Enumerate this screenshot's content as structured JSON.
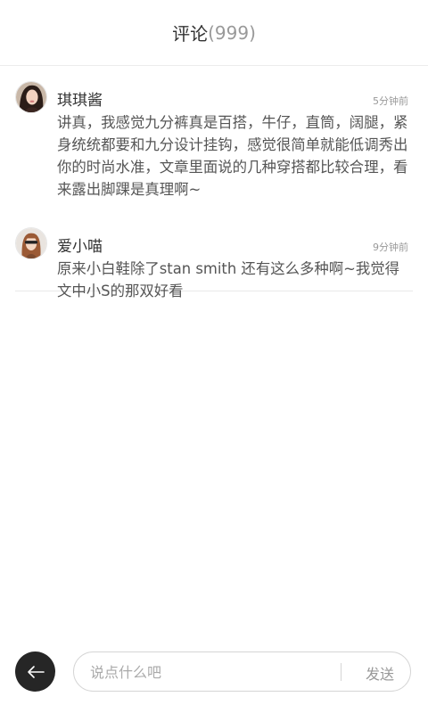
{
  "header": {
    "title": "评论",
    "count": "(999)"
  },
  "comments": [
    {
      "username": "琪琪酱",
      "time": "5分钟前",
      "text": "讲真，我感觉九分裤真是百搭，牛仔，直筒，阔腿，紧身统统都要和九分设计挂钩，感觉很简单就能低调秀出你的时尚水准，文章里面说的几种穿搭都比较合理，看来露出脚踝是真理啊~"
    },
    {
      "username": "爱小喵",
      "time": "9分钟前",
      "text": "原来小白鞋除了stan smith 还有这么多种啊~我觉得文中小S的那双好看"
    }
  ],
  "composer": {
    "placeholder": "说点什么吧",
    "send_label": "发送",
    "back_icon": "arrow-left-icon"
  },
  "colors": {
    "back_button": "#262626",
    "border": "#d5d5d5",
    "muted": "#999999"
  }
}
